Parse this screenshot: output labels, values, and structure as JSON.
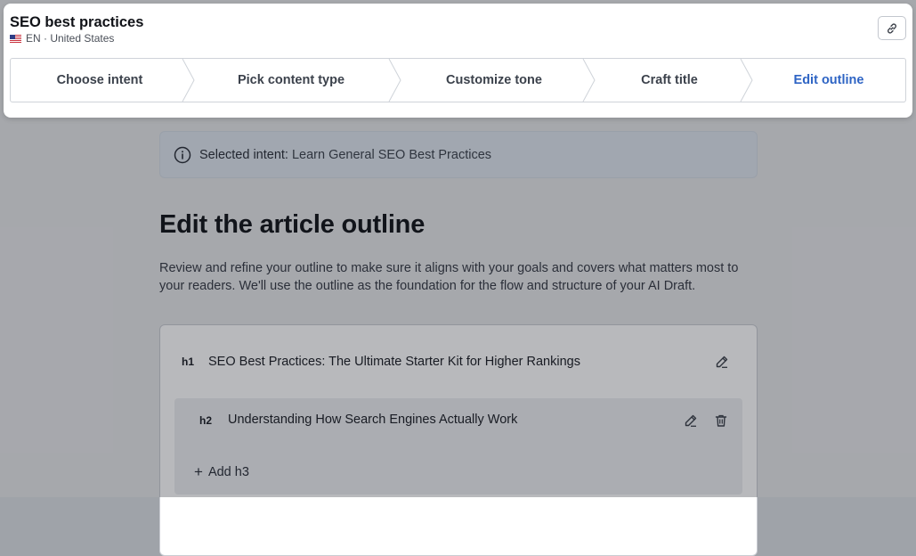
{
  "header": {
    "title": "SEO best practices",
    "locale": "EN · United States",
    "link_icon": "link-icon",
    "flag_icon": "us-flag-icon"
  },
  "steps": [
    {
      "label": "Choose intent",
      "active": false
    },
    {
      "label": "Pick content type",
      "active": false
    },
    {
      "label": "Customize tone",
      "active": false
    },
    {
      "label": "Craft title",
      "active": false
    },
    {
      "label": "Edit outline",
      "active": true
    }
  ],
  "colors": {
    "accent": "#2e64c4",
    "overlay": "rgba(20,24,34,0.30)"
  },
  "main": {
    "alert": {
      "icon": "info-icon",
      "label": "Selected intent:",
      "value": "Learn General SEO Best Practices"
    },
    "heading": "Edit the article outline",
    "description": "Review and refine your outline to make sure it aligns with your goals and covers what matters most to your readers. We'll use the outline as the foundation for the flow and structure of your AI Draft.",
    "outline": {
      "h1": {
        "tag": "h1",
        "text": "SEO Best Practices: The Ultimate Starter Kit for Higher Rankings"
      },
      "h2": [
        {
          "tag": "h2",
          "text": "Understanding How Search Engines Actually Work"
        }
      ],
      "add_h3_label": "Add h3"
    }
  }
}
